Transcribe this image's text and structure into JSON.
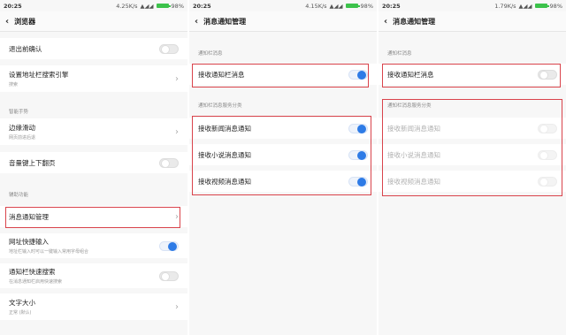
{
  "status_bars": [
    {
      "time": "20:25",
      "network": "4.25K/s",
      "battery": "98%"
    },
    {
      "time": "20:25",
      "network": "4.15K/s",
      "battery": "98%"
    },
    {
      "time": "20:25",
      "network": "1.79K/s",
      "battery": "98%"
    }
  ],
  "screen1": {
    "title": "浏览器",
    "items": {
      "exit_confirm": "退出前确认",
      "address_search": "设置地址栏搜索引擎",
      "address_search_sub": "搜索",
      "gesture_section": "智能手势",
      "edge_slide": "边缘滑动",
      "edge_slide_sub": "网页前进后退",
      "volume_page": "音量键上下翻页",
      "aux_section": "辅助功能",
      "notification_mgmt": "消息通知管理",
      "quick_input": "网址快捷输入",
      "quick_input_sub": "地址栏输入时可以一键输入常用字母组合",
      "notif_quick_search": "通知栏快速搜索",
      "notif_quick_search_sub": "在消息通知栏启用快速搜索",
      "font_size": "文字大小",
      "font_size_sub": "正常 (默认)"
    }
  },
  "screen2": {
    "title": "消息通知管理",
    "section1": "通知栏消息",
    "receive_notif": "接收通知栏消息",
    "section2": "通知栏消息服务分类",
    "news": "接收新闻消息通知",
    "novel": "接收小说消息通知",
    "video": "接收视频消息通知"
  },
  "screen3": {
    "title": "消息通知管理",
    "section1": "通知栏消息",
    "receive_notif": "接收通知栏消息",
    "section2": "通知栏消息服务分类",
    "news": "接收新闻消息通知",
    "novel": "接收小说消息通知",
    "video": "接收视频消息通知"
  },
  "colors": {
    "highlight": "#d9434b",
    "toggle_on": "#2e7be6",
    "battery": "#3cc24b"
  }
}
